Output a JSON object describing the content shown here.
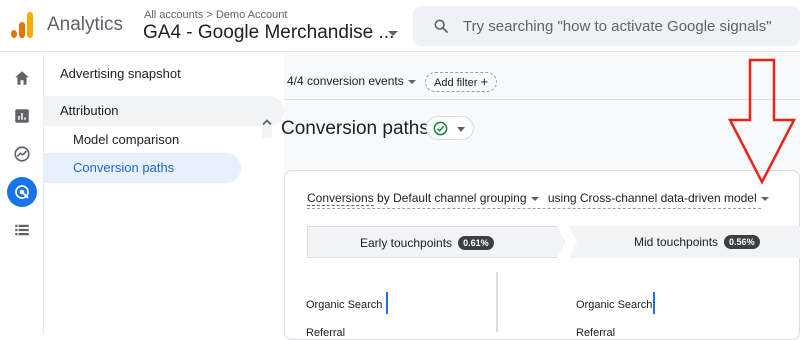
{
  "header": {
    "app_name": "Analytics",
    "breadcrumb": "All accounts > Demo Account",
    "property_name": "GA4 - Google Merchandise ...",
    "search_placeholder": "Try searching \"how to activate Google signals\""
  },
  "rail": {
    "icons": [
      "home-icon",
      "reports-icon",
      "explore-icon",
      "advertising-icon",
      "configure-icon"
    ],
    "active": "advertising-icon"
  },
  "nav": {
    "advertising_snapshot": "Advertising snapshot",
    "attribution": "Attribution",
    "model_comparison": "Model comparison",
    "conversion_paths": "Conversion paths"
  },
  "toolbar": {
    "conversion_events": "4/4 conversion events",
    "add_filter": "Add filter"
  },
  "page": {
    "title": "Conversion paths"
  },
  "card": {
    "metric": "Conversions",
    "by_text": "by",
    "dimension": "Default channel grouping",
    "using_text": "using",
    "model": "Cross-channel data-driven model"
  },
  "touchpoints": {
    "early_label": "Early touchpoints",
    "early_pct": "0.61%",
    "mid_label": "Mid touchpoints",
    "mid_pct": "0.56%"
  },
  "panels": {
    "left": [
      "Organic Search",
      "Referral"
    ],
    "right": [
      "Organic Search",
      "Referral"
    ]
  },
  "colors": {
    "brand_orange": "#e37400",
    "brand_yellow": "#f9ab00",
    "active_blue": "#1a73e8",
    "arrow_red": "#e8231c",
    "success_green": "#188038"
  }
}
